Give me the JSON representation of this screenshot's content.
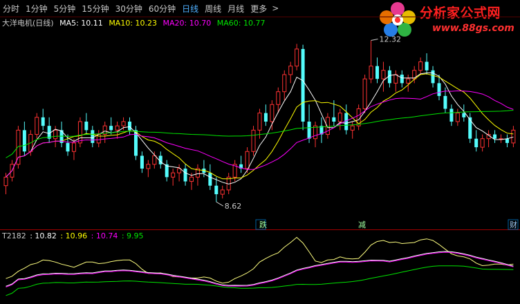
{
  "toolbar": {
    "periods": [
      {
        "label": "分时",
        "active": false
      },
      {
        "label": "1分钟",
        "active": false
      },
      {
        "label": "5分钟",
        "active": false
      },
      {
        "label": "15分钟",
        "active": false
      },
      {
        "label": "30分钟",
        "active": false
      },
      {
        "label": "60分钟",
        "active": false
      },
      {
        "label": "日线",
        "active": true
      },
      {
        "label": "周线",
        "active": false
      },
      {
        "label": "月线",
        "active": false
      },
      {
        "label": "更多",
        "active": false
      }
    ],
    "more_arrow": ">"
  },
  "logo": {
    "text": "分析家公式网",
    "url": "www.88gs.com"
  },
  "main_legend": {
    "stock_name": "大洋电机(日线)",
    "ma5": "MA5: 10.11",
    "ma10": "MA10: 10.23",
    "ma20": "MA20: 10.70",
    "ma60": "MA60: 10.77"
  },
  "sub_legend": {
    "name": "T2182",
    "v1": ": 10.82",
    "v2": ": 10.96",
    "v3": ": 10.74",
    "v4": ": 9.95"
  },
  "annotations": {
    "high": "12.32",
    "low": "8.62",
    "markers": [
      "跌",
      "减",
      "财"
    ]
  },
  "colors": {
    "up": "#ff3232",
    "down": "#54fcfc",
    "ma5": "#ffffff",
    "ma10": "#ffff00",
    "ma20": "#ff00ff",
    "ma60": "#00e600",
    "divider": "#a00000",
    "period_active": "#4fb0ff"
  },
  "chart_data": {
    "type": "candlestick",
    "ohlc": [
      [
        9.0,
        9.3,
        8.8,
        9.2
      ],
      [
        9.2,
        9.6,
        9.1,
        9.5
      ],
      [
        9.5,
        10.4,
        9.4,
        10.3
      ],
      [
        10.3,
        10.5,
        9.7,
        9.8
      ],
      [
        9.8,
        10.3,
        9.7,
        10.2
      ],
      [
        10.2,
        10.7,
        10.1,
        10.6
      ],
      [
        10.6,
        10.8,
        10.3,
        10.4
      ],
      [
        10.4,
        10.6,
        10.0,
        10.1
      ],
      [
        10.1,
        10.4,
        9.9,
        10.3
      ],
      [
        10.3,
        10.5,
        9.9,
        10.0
      ],
      [
        10.0,
        10.2,
        9.7,
        9.8
      ],
      [
        9.8,
        10.1,
        9.6,
        10.0
      ],
      [
        10.0,
        10.6,
        9.9,
        10.5
      ],
      [
        10.5,
        10.7,
        10.2,
        10.3
      ],
      [
        10.3,
        10.4,
        9.9,
        10.0
      ],
      [
        10.0,
        10.3,
        9.9,
        10.2
      ],
      [
        10.2,
        10.5,
        10.0,
        10.4
      ],
      [
        10.4,
        10.6,
        10.2,
        10.3
      ],
      [
        10.3,
        10.5,
        10.1,
        10.4
      ],
      [
        10.4,
        10.6,
        10.3,
        10.5
      ],
      [
        10.5,
        10.6,
        10.2,
        10.3
      ],
      [
        10.3,
        10.4,
        9.6,
        9.7
      ],
      [
        9.7,
        9.8,
        9.3,
        9.4
      ],
      [
        9.4,
        9.6,
        9.2,
        9.5
      ],
      [
        9.5,
        9.8,
        9.4,
        9.7
      ],
      [
        9.7,
        9.8,
        9.4,
        9.5
      ],
      [
        9.5,
        9.6,
        9.1,
        9.2
      ],
      [
        9.2,
        9.4,
        9.0,
        9.3
      ],
      [
        9.3,
        9.5,
        9.1,
        9.4
      ],
      [
        9.4,
        9.5,
        9.0,
        9.1
      ],
      [
        9.1,
        9.3,
        8.9,
        9.2
      ],
      [
        9.2,
        9.5,
        9.0,
        9.4
      ],
      [
        9.4,
        9.6,
        9.2,
        9.3
      ],
      [
        9.3,
        9.5,
        8.9,
        9.0
      ],
      [
        9.0,
        9.2,
        8.62,
        8.8
      ],
      [
        8.8,
        9.0,
        8.7,
        8.9
      ],
      [
        8.9,
        9.3,
        8.8,
        9.2
      ],
      [
        9.2,
        9.6,
        9.1,
        9.5
      ],
      [
        9.5,
        9.7,
        9.3,
        9.4
      ],
      [
        9.4,
        9.9,
        9.3,
        9.8
      ],
      [
        9.8,
        10.4,
        9.7,
        10.3
      ],
      [
        10.3,
        10.8,
        10.1,
        10.7
      ],
      [
        10.7,
        10.9,
        10.4,
        10.5
      ],
      [
        10.5,
        11.0,
        10.3,
        10.9
      ],
      [
        10.9,
        11.3,
        10.7,
        11.2
      ],
      [
        11.2,
        11.7,
        11.0,
        11.6
      ],
      [
        11.6,
        11.9,
        11.4,
        11.8
      ],
      [
        11.8,
        12.32,
        11.7,
        12.2
      ],
      [
        12.2,
        12.3,
        10.3,
        10.5
      ],
      [
        10.5,
        10.9,
        10.0,
        10.1
      ],
      [
        10.1,
        10.5,
        9.9,
        10.4
      ],
      [
        10.4,
        10.6,
        10.0,
        10.2
      ],
      [
        10.2,
        10.7,
        10.1,
        10.6
      ],
      [
        10.6,
        11.0,
        10.4,
        10.5
      ],
      [
        10.5,
        10.8,
        10.3,
        10.7
      ],
      [
        10.7,
        10.9,
        10.2,
        10.3
      ],
      [
        10.3,
        10.5,
        10.1,
        10.4
      ],
      [
        10.4,
        10.9,
        10.3,
        10.8
      ],
      [
        10.8,
        11.6,
        10.7,
        11.5
      ],
      [
        11.5,
        12.4,
        11.4,
        11.8
      ],
      [
        11.8,
        12.0,
        11.4,
        11.5
      ],
      [
        11.5,
        11.9,
        11.2,
        11.7
      ],
      [
        11.7,
        11.8,
        11.3,
        11.4
      ],
      [
        11.4,
        11.7,
        11.2,
        11.6
      ],
      [
        11.6,
        11.7,
        11.3,
        11.4
      ],
      [
        11.4,
        11.6,
        11.2,
        11.5
      ],
      [
        11.5,
        11.8,
        11.4,
        11.7
      ],
      [
        11.7,
        12.0,
        11.6,
        11.9
      ],
      [
        11.9,
        12.1,
        11.6,
        11.7
      ],
      [
        11.7,
        11.8,
        11.3,
        11.4
      ],
      [
        11.4,
        11.6,
        11.0,
        11.1
      ],
      [
        11.1,
        11.3,
        10.7,
        10.8
      ],
      [
        10.8,
        10.9,
        10.4,
        10.5
      ],
      [
        10.5,
        10.8,
        10.4,
        10.7
      ],
      [
        10.7,
        10.9,
        10.5,
        10.6
      ],
      [
        10.6,
        10.7,
        10.0,
        10.1
      ],
      [
        10.1,
        10.3,
        9.8,
        9.9
      ],
      [
        9.9,
        10.2,
        9.8,
        10.1
      ],
      [
        10.1,
        10.3,
        9.9,
        10.2
      ],
      [
        10.2,
        10.3,
        10.0,
        10.1
      ],
      [
        10.1,
        10.2,
        10.0,
        10.1
      ],
      [
        10.1,
        10.2,
        9.9,
        10.0
      ],
      [
        10.0,
        10.4,
        9.9,
        10.3
      ]
    ],
    "ma_lines": [
      "MA5",
      "MA10",
      "MA20",
      "MA60"
    ],
    "indicator_lines": [
      "T2182 line1",
      "T2182 line2",
      "T2182 line3",
      "T2182 line4"
    ],
    "high_label": 12.32,
    "low_label": 8.62
  }
}
